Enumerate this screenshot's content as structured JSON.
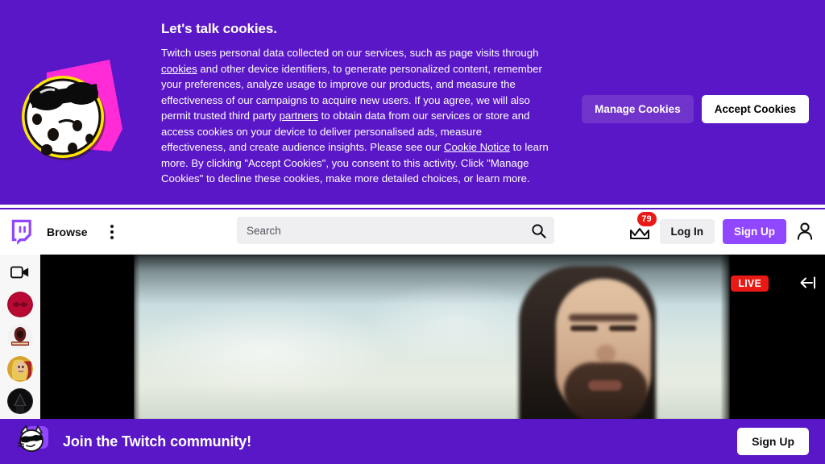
{
  "cookie_banner": {
    "title": "Let's talk cookies.",
    "body_part1": "Twitch uses personal data collected on our services, such as page visits through ",
    "link_cookies": "cookies",
    "body_part2": " and other device identifiers, to generate personalized content, remember your preferences, analyze usage to improve our products, and measure the effectiveness of our campaigns to acquire new users.   If you agree, we will also permit trusted third party ",
    "link_partners": "partners",
    "body_part3": " to obtain data from our services or store and access cookies on your device to deliver personalised ads, measure effectiveness, and create audience insights. Please see our ",
    "link_cookie_notice": "Cookie Notice",
    "body_part4": " to learn more. By clicking \"Accept Cookies\", you consent to this activity. Click \"Manage Cookies\" to decline these cookies, make more detailed choices, or learn more.",
    "manage_label": "Manage Cookies",
    "accept_label": "Accept Cookies",
    "background_color": "#5A17C8",
    "manage_button_color": "#7033CB",
    "mascot": "cookie-with-sunglasses"
  },
  "topnav": {
    "logo": "twitch-logo",
    "browse_label": "Browse",
    "kebab_icon": "kebab-menu-icon",
    "search": {
      "placeholder": "Search",
      "value": "",
      "search_icon": "search-icon"
    },
    "prime_icon": "prime-crown-icon",
    "notification_count": "79",
    "notification_color": "#E91916",
    "login_label": "Log In",
    "signup_label": "Sign Up",
    "signup_color": "#9147FF",
    "account_icon": "account-person-icon"
  },
  "sidebar": {
    "camera_icon": "video-camera-icon",
    "items": [
      {
        "name": "channel-avatar-1",
        "art": "crimson-infinity"
      },
      {
        "name": "channel-avatar-2",
        "art": "dark-crest"
      },
      {
        "name": "channel-avatar-3",
        "art": "blonde-portrait"
      },
      {
        "name": "channel-avatar-4",
        "art": "dark-figure"
      }
    ]
  },
  "player": {
    "live_label": "LIVE",
    "live_color": "#E91916",
    "collapse_icon": "collapse-left-arrow-icon",
    "stream_description": "blurred bearded person against bright sky background"
  },
  "signup_bar": {
    "mascot": "cool-cat-with-sunglasses",
    "title": "Join the Twitch community!",
    "signup_label": "Sign Up",
    "background_color": "#5A17C8"
  }
}
